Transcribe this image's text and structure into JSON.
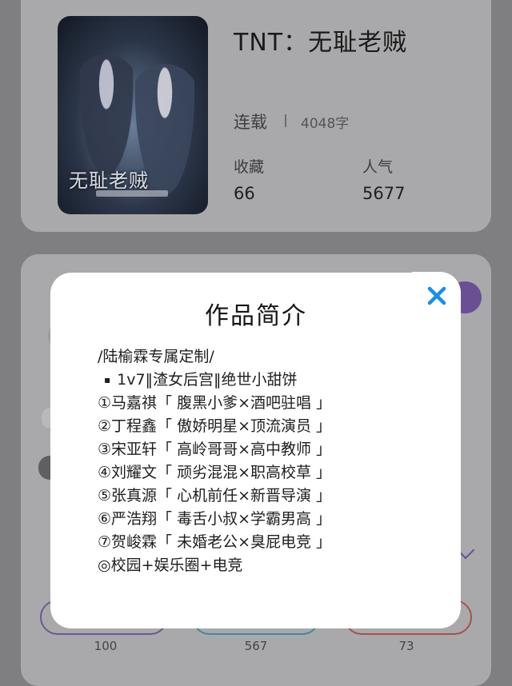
{
  "book": {
    "title": "TNT：无耻老贼",
    "cover_title": "无耻老贼",
    "status": "连载",
    "word_count": "4048字",
    "stats": [
      {
        "label": "收藏",
        "value": "66"
      },
      {
        "label": "人气",
        "value": "5677"
      }
    ]
  },
  "actions": {
    "counts": [
      "100",
      "567",
      "73"
    ],
    "colors": [
      "#7a5aa8",
      "#3aa9c9",
      "#d9534f"
    ]
  },
  "modal": {
    "title": "作品简介",
    "lines": [
      {
        "text": "/陆榆霖专属定制/",
        "bullet": false
      },
      {
        "text": "1v7‖渣女后宫‖绝世小甜饼",
        "bullet": true
      },
      {
        "text": "①马嘉祺「 腹黑小爹×酒吧驻唱 」",
        "bullet": false
      },
      {
        "text": "②丁程鑫「 傲娇明星×顶流演员 」",
        "bullet": false
      },
      {
        "text": "③宋亚轩「 高岭哥哥×高中教师 」",
        "bullet": false
      },
      {
        "text": "④刘耀文「 顽劣混混×职高校草 」",
        "bullet": false
      },
      {
        "text": "⑤张真源「 心机前任×新晋导演 」",
        "bullet": false
      },
      {
        "text": "⑥严浩翔「 毒舌小叔×学霸男高 」",
        "bullet": false
      },
      {
        "text": "⑦贺峻霖「 未婚老公×臭屁电竞 」",
        "bullet": false
      },
      {
        "text": "◎校园+娱乐圈+电竞",
        "bullet": false
      }
    ],
    "close_icon": "close-icon",
    "accent": "#1b8fe0"
  }
}
